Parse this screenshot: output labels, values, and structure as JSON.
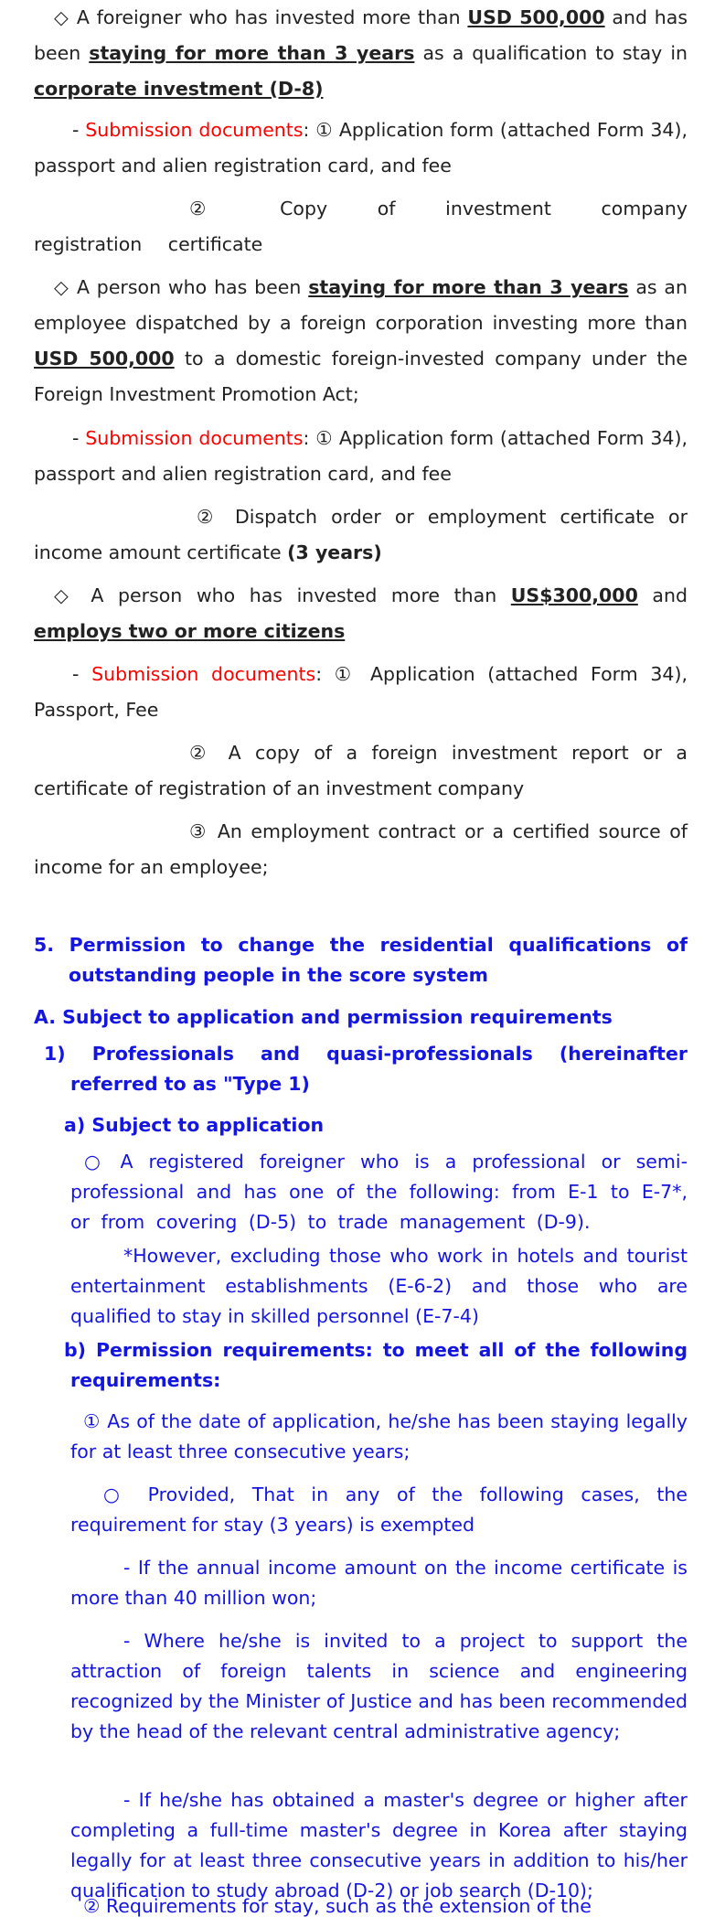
{
  "block1": {
    "pre1": "◇ A foreigner who has invested more than ",
    "amount": "USD 500,000",
    "mid": " and has been ",
    "stay": "staying for more than 3 years",
    "post": " as a qualification to stay in ",
    "visa": "corporate investment (D-8)"
  },
  "sub1": {
    "dash": "- ",
    "label": "Submission documents",
    "text": ": ① Application form (attached Form 34), passport and alien registration card, and fee",
    "item2": "② Copy of investment company registration certificate"
  },
  "block2": {
    "pre": "◇ A person who has been ",
    "stay": "staying for more than 3 years",
    "mid": " as an employee dispatched by a foreign corporation investing more than ",
    "amount": "USD 500,000",
    "post": " to a domestic foreign-invested company under the Foreign Investment Promotion Act;"
  },
  "sub2": {
    "dash": "- ",
    "label": "Submission documents",
    "text": ": ① Application form (attached Form 34), passport and alien registration card, and fee",
    "item2a": "② Dispatch order or employment certificate or income amount certificate ",
    "item2b": "(3 years)"
  },
  "block3": {
    "pre": "◇ A person who has invested more than ",
    "amount": "US$300,000",
    "mid": " and ",
    "employs": "employs two or more citizens"
  },
  "sub3": {
    "dash": "- ",
    "label": "Submission documents",
    "text": ": ① Application (attached Form 34), Passport, Fee",
    "item2": "② A copy of a foreign investment report or a certificate of registration of an investment company",
    "item3": "③ An employment contract or a certified source of income for an employee;"
  },
  "section5": {
    "title": "5. Permission to change the residential qualifications of outstanding people in the score system",
    "a": "A. Subject to application and permission requirements",
    "one": "1) Professionals and quasi-professionals (hereinafter referred to as \"Type 1)",
    "a_sub": "a) Subject to application",
    "circle1": "○ A registered foreigner who is a professional or semi-professional and has one of the following: from E-1 to E-7*, or from covering (D-5) to trade management (D-9).",
    "however": "*However, excluding those who work in hotels and tourist entertainment establishments (E-6-2) and those who are qualified to stay in skilled personnel (E-7-4)",
    "b_sub": "b) Permission requirements: to meet all of the following requirements:",
    "req1": "① As of the date of application, he/she has been staying legally for at least three consecutive years;",
    "provided": "○ Provided, That in any of the following cases, the requirement for stay (3 years) is exempted",
    "dash1": "- If the annual income amount on the income certificate is more than 40 million won;",
    "dash2": "- Where he/she is invited to a project to support the attraction of foreign talents in science and engineering recognized by the Minister of Justice and has been recommended by the head of the relevant central administrative agency;",
    "dash3": "- If he/she has obtained a master's degree or higher after completing a full-time master's degree in Korea after staying legally for at least three consecutive years in addition to his/her qualification to study abroad (D-2) or job search (D-10);",
    "req2": "② Requirements for stay, such as the extension of the"
  }
}
